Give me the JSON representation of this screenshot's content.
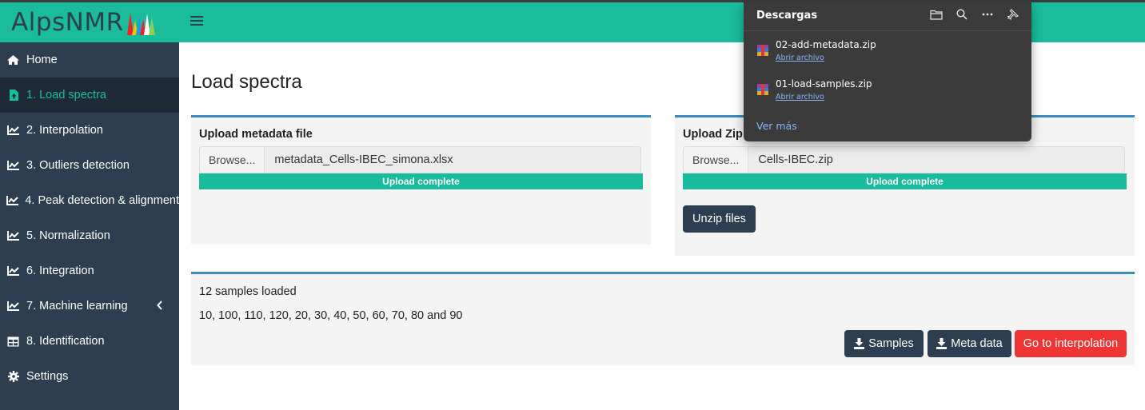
{
  "app": {
    "logo_text": "AlpsNMR",
    "colors": {
      "header": "#1abc9c",
      "sidebar": "#2c3e50",
      "active": "#1abc9c",
      "box_accent": "#3c8dbc",
      "danger": "#ef3434"
    }
  },
  "sidebar": {
    "items": [
      {
        "label": "Home",
        "icon": "home-icon"
      },
      {
        "label": "1. Load spectra",
        "icon": "file-upload-icon",
        "active": true
      },
      {
        "label": "2. Interpolation",
        "icon": "line-chart-icon"
      },
      {
        "label": "3. Outliers detection",
        "icon": "line-chart-icon"
      },
      {
        "label": "4. Peak detection & alignment",
        "icon": "line-chart-icon"
      },
      {
        "label": "5. Normalization",
        "icon": "line-chart-icon"
      },
      {
        "label": "6. Integration",
        "icon": "line-chart-icon"
      },
      {
        "label": "7. Machine learning",
        "icon": "line-chart-icon",
        "chevron": "chevron-left-icon"
      },
      {
        "label": "8. Identification",
        "icon": "table-icon"
      },
      {
        "label": "Settings",
        "icon": "gear-icon"
      }
    ]
  },
  "main": {
    "title": "Load spectra",
    "metadata_box": {
      "title": "Upload metadata file",
      "browse_label": "Browse...",
      "file_name": "metadata_Cells-IBEC_simona.xlsx",
      "progress_label": "Upload complete",
      "progress": 1.0
    },
    "zip_box": {
      "title": "Upload Zip",
      "browse_label": "Browse...",
      "file_name": "Cells-IBEC.zip",
      "progress_label": "Upload complete",
      "progress": 1.0,
      "unzip_label": "Unzip files"
    },
    "samples_box": {
      "count_text": "12 samples loaded",
      "sample_list": "10, 100, 110, 120, 20, 30, 40, 50, 60, 70, 80 and 90",
      "samples_button": "Samples",
      "metadata_button": "Meta data",
      "goto_button": "Go to interpolation"
    }
  },
  "downloads": {
    "title": "Descargas",
    "items": [
      {
        "file": "02-add-metadata.zip",
        "action": "Abrir archivo"
      },
      {
        "file": "01-load-samples.zip",
        "action": "Abrir archivo"
      }
    ],
    "more_label": "Ver más"
  }
}
